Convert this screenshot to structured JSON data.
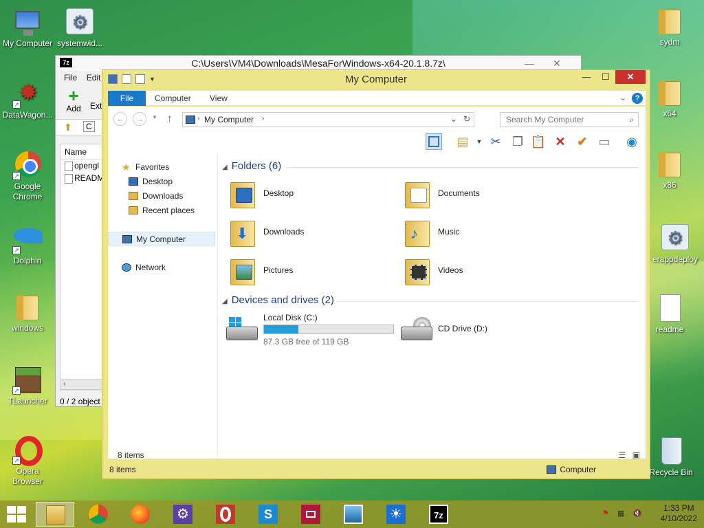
{
  "desktop": {
    "icons": [
      {
        "label": "My Computer"
      },
      {
        "label": "systemwid..."
      },
      {
        "label": "DataWagon..."
      },
      {
        "label": "Google Chrome"
      },
      {
        "label": "Dolphin"
      },
      {
        "label": "windows"
      },
      {
        "label": "TLauncher"
      },
      {
        "label": "Opera Browser"
      },
      {
        "label": "sydm"
      },
      {
        "label": "x64"
      },
      {
        "label": "x86"
      },
      {
        "label": "erappdeploy"
      },
      {
        "label": "readme"
      },
      {
        "label": "Recycle Bin"
      }
    ]
  },
  "back_window": {
    "app_icon": "7z",
    "title": "C:\\Users\\VM4\\Downloads\\MesaForWindows-x64-20.1.8.7z\\",
    "minimize": "—",
    "close": "✕",
    "menu": [
      "File",
      "Edit"
    ],
    "add_label": "Add",
    "extract_label": "Extr",
    "path_fragment": "C",
    "list_header": "Name",
    "rows": [
      "opengl",
      "READM"
    ],
    "status": "0 / 2 object"
  },
  "explorer": {
    "title": "My Computer",
    "tabs": {
      "file": "File",
      "computer": "Computer",
      "view": "View"
    },
    "help": "?",
    "address": "My Computer",
    "search_placeholder": "Search My Computer",
    "nav": {
      "favorites": "Favorites",
      "desktop": "Desktop",
      "downloads": "Downloads",
      "recent": "Recent places",
      "my_computer": "My Computer",
      "network": "Network"
    },
    "folders_header": "Folders (6)",
    "folders": [
      {
        "name": "Desktop"
      },
      {
        "name": "Documents"
      },
      {
        "name": "Downloads"
      },
      {
        "name": "Music"
      },
      {
        "name": "Pictures"
      },
      {
        "name": "Videos"
      }
    ],
    "devices_header": "Devices and drives (2)",
    "drive_c": {
      "name": "Local Disk (C:)",
      "free": "87.3 GB free of 119 GB",
      "used_fraction": 0.266
    },
    "drive_d": {
      "name": "CD Drive (D:)"
    },
    "items_count": "8 items",
    "status_left": "8 items",
    "status_right": "Computer"
  },
  "taskbar": {
    "time": "1:33 PM",
    "date": "4/10/2022",
    "apps": [
      "file-explorer",
      "chrome",
      "firefox",
      "settings",
      "opera",
      "skype",
      "screen-recorder",
      "photos",
      "brightness",
      "7zip"
    ]
  },
  "colors": {
    "accent": "#1979ca",
    "close_red": "#c9302c",
    "window_frame": "#ece58a",
    "progress": "#26a0da"
  }
}
